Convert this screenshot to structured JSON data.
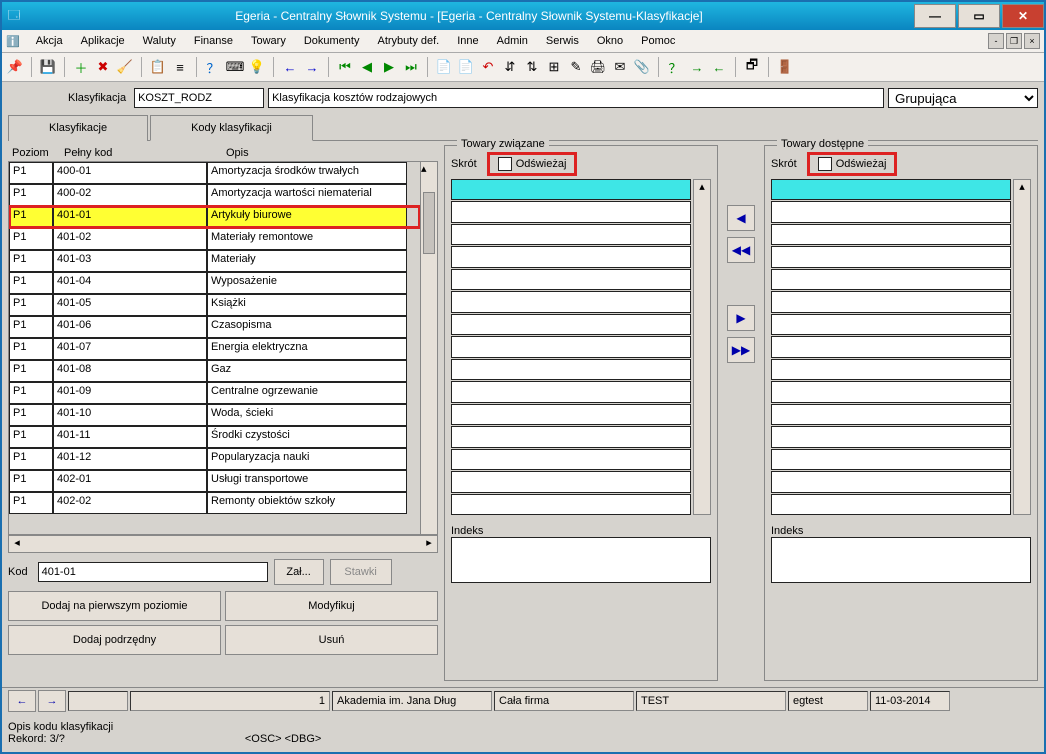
{
  "title": "Egeria - Centralny Słownik Systemu - [Egeria - Centralny Słownik Systemu-Klasyfikacje]",
  "menu": [
    "Akcja",
    "Aplikacje",
    "Waluty",
    "Finanse",
    "Towary",
    "Dokumenty",
    "Atrybuty def.",
    "Inne",
    "Admin",
    "Serwis",
    "Okno",
    "Pomoc"
  ],
  "header": {
    "klasyfikacja_label": "Klasyfikacja",
    "klasyfikacja_code": "KOSZT_RODZ",
    "klasyfikacja_desc": "Klasyfikacja kosztów rodzajowych",
    "combo": "Grupująca"
  },
  "tabs": {
    "t1": "Klasyfikacje",
    "t2": "Kody klasyfikacji"
  },
  "grid": {
    "hdr": {
      "c0": "Poziom",
      "c1": "Pełny kod",
      "c2": "Opis"
    },
    "rows": [
      {
        "p": "P1",
        "k": "400-01",
        "o": "Amortyzacja środków trwałych"
      },
      {
        "p": "P1",
        "k": "400-02",
        "o": "Amortyzacja wartości niematerial"
      },
      {
        "p": "P1",
        "k": "401-01",
        "o": "Artykuły biurowe",
        "sel": true
      },
      {
        "p": "P1",
        "k": "401-02",
        "o": "Materiały remontowe"
      },
      {
        "p": "P1",
        "k": "401-03",
        "o": "Materiały"
      },
      {
        "p": "P1",
        "k": "401-04",
        "o": "Wyposażenie"
      },
      {
        "p": "P1",
        "k": "401-05",
        "o": "Książki"
      },
      {
        "p": "P1",
        "k": "401-06",
        "o": "Czasopisma"
      },
      {
        "p": "P1",
        "k": "401-07",
        "o": "Energia elektryczna"
      },
      {
        "p": "P1",
        "k": "401-08",
        "o": "Gaz"
      },
      {
        "p": "P1",
        "k": "401-09",
        "o": "Centralne ogrzewanie"
      },
      {
        "p": "P1",
        "k": "401-10",
        "o": "Woda, ścieki"
      },
      {
        "p": "P1",
        "k": "401-11",
        "o": "Środki czystości"
      },
      {
        "p": "P1",
        "k": "401-12",
        "o": "Popularyzacja nauki"
      },
      {
        "p": "P1",
        "k": "402-01",
        "o": "Usługi transportowe"
      },
      {
        "p": "P1",
        "k": "402-02",
        "o": "Remonty obiektów szkoły"
      }
    ]
  },
  "kod": {
    "label": "Kod",
    "value": "401-01",
    "zal": "Zał...",
    "stawki": "Stawki"
  },
  "btns": {
    "b1": "Dodaj na pierwszym poziomie",
    "b2": "Modyfikuj",
    "b3": "Dodaj podrzędny",
    "b4": "Usuń"
  },
  "panel_left": {
    "title": "Towary związane",
    "skrot": "Skrót",
    "odswiezaj": "Odświeżaj",
    "indeks": "Indeks"
  },
  "panel_right": {
    "title": "Towary dostępne",
    "skrot": "Skrót",
    "odswiezaj": "Odświeżaj",
    "indeks": "Indeks"
  },
  "bottom": {
    "num": "1",
    "org": "Akademia im. Jana Dług",
    "scope": "Cała firma",
    "env": "TEST",
    "user": "egtest",
    "date": "11-03-2014"
  },
  "status": {
    "line1": "Opis kodu klasyfikacji",
    "line2": "Rekord: 3/?",
    "osc": "<OSC>",
    "dbg": "<DBG>"
  }
}
